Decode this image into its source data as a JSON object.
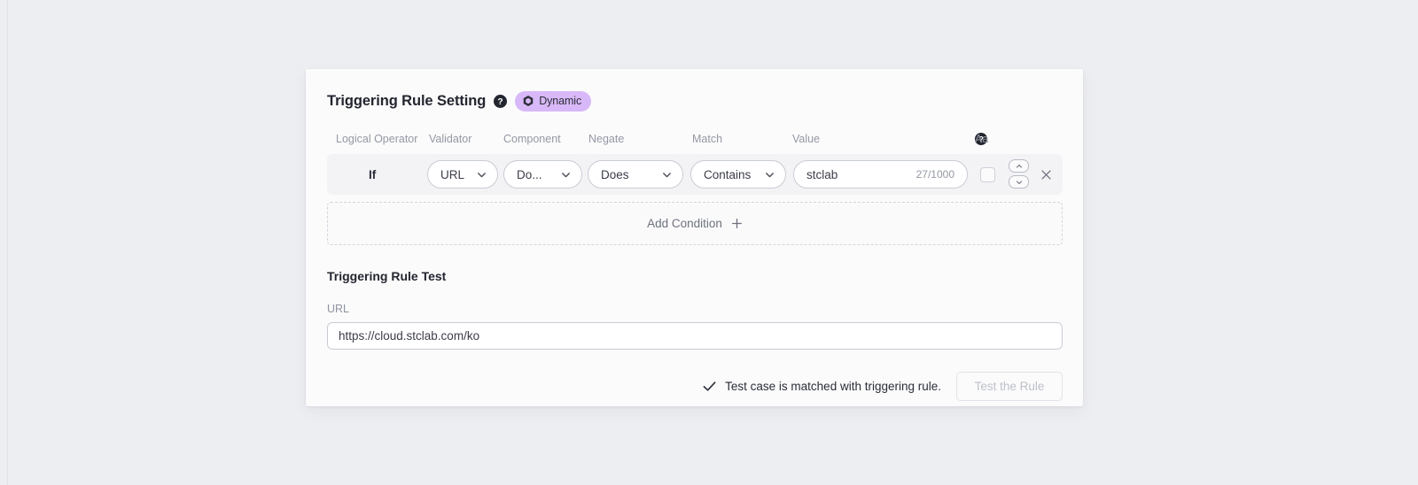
{
  "card": {
    "title": "Triggering Rule Setting",
    "title_help_icon": "help-circle-icon",
    "badge": {
      "label": "Dynamic",
      "icon": "cube-icon",
      "background": "#d8b8f8"
    }
  },
  "columns": {
    "logical_operator": "Logical Operator",
    "validator": "Validator",
    "component": "Component",
    "negate": "Negate",
    "match": "Match",
    "value": "Value",
    "case_sensitivity": "Aa",
    "case_sensitivity_help_icon": "help-circle-icon"
  },
  "condition": {
    "logical_operator": "If",
    "validator": "URL",
    "component": "Do...",
    "negate": "Does",
    "match": "Contains",
    "value": "stclab",
    "value_counter": "27/1000",
    "case_sensitive_checked": false,
    "move_up_icon": "chevron-up-icon",
    "move_down_icon": "chevron-down-icon",
    "remove_icon": "close-icon",
    "dropdown_icon": "chevron-down-icon"
  },
  "add_condition": {
    "label": "Add Condition",
    "icon": "plus-icon"
  },
  "test_section": {
    "title": "Triggering Rule Test",
    "url_label": "URL",
    "url_value": "https://cloud.stclab.com/ko",
    "url_placeholder": "https://cloud.stclab.com/ko",
    "status_icon": "check-icon",
    "status_text": "Test case is matched with triggering rule.",
    "test_button_label": "Test the Rule"
  }
}
